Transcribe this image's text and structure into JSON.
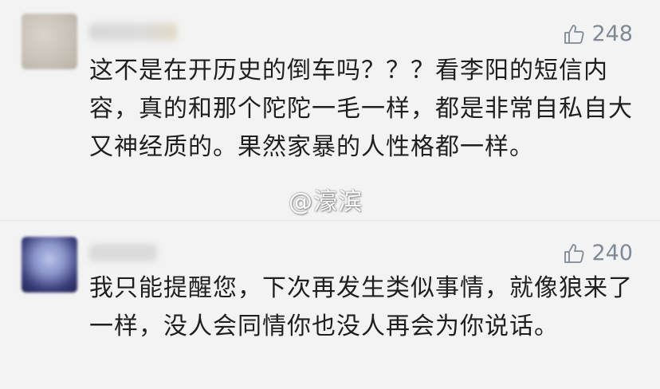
{
  "comments": [
    {
      "like_count": "248",
      "text": "这不是在开历史的倒车吗？？？看李阳的短信内容，真的和那个陀陀一毛一样，都是非常自私自大又神经质的。果然家暴的人性格都一样。"
    },
    {
      "like_count": "240",
      "text": "我只能提醒您，下次再发生类似事情，就像狼来了一样，没人会同情你也没人再会为你说话。"
    }
  ],
  "watermark": "@濠滨",
  "icons": {
    "like": "thumbs-up-icon"
  },
  "colors": {
    "background": "#f3f3f3",
    "text": "#1f1f1f",
    "like": "#7f8a96"
  }
}
